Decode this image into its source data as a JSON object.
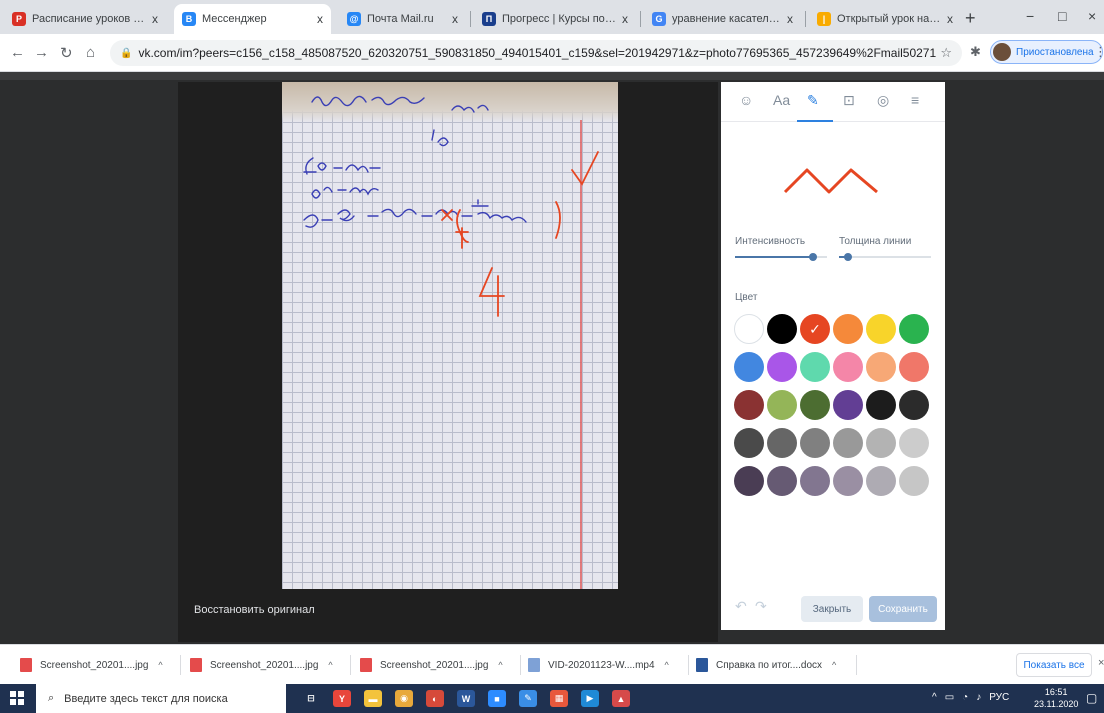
{
  "browser": {
    "tabs": [
      {
        "title": "Расписание уроков на II чет",
        "fav_color": "#d93025",
        "fav_glyph": "Р",
        "active": false
      },
      {
        "title": "Мессенджер",
        "fav_color": "#2787f5",
        "fav_glyph": "В",
        "active": true
      },
      {
        "title": "Почта Mail.ru",
        "fav_color": "#2787f5",
        "fav_glyph": "@",
        "active": false
      },
      {
        "title": "Прогресс | Курсы повыше",
        "fav_color": "#1a3e8c",
        "fav_glyph": "П",
        "active": false
      },
      {
        "title": "уравнение касательной БА",
        "fav_color": "#4285f4",
        "fav_glyph": "G",
        "active": false
      },
      {
        "title": "Открытый урок на тему: Ур",
        "fav_color": "#f9ab00",
        "fav_glyph": "|",
        "active": false
      }
    ],
    "tab_close": "x",
    "new_tab": "+",
    "window_controls": [
      "−",
      "□",
      "×"
    ],
    "url": "vk.com/im?peers=c156_c158_485087520_620320751_590831850_494015401_c159&sel=201942971&z=photo77695365_457239649%2Fmail50271",
    "profile_label": "Приостановлена"
  },
  "editor": {
    "tab_icons": [
      "smile-icon",
      "text-icon",
      "brush-icon",
      "crop-icon",
      "filter-icon",
      "settings-icon"
    ],
    "text_tab_label": "Aa",
    "intensity_label": "Интенсивность",
    "intensity_value": 0.85,
    "thickness_label": "Толщина линии",
    "thickness_value": 0.1,
    "color_label": "Цвет",
    "selected_color": "#e64622",
    "colors": [
      "#ffffff",
      "#000000",
      "#e64622",
      "#f5893a",
      "#f8d42a",
      "#2ab34f",
      "#4287e0",
      "#a956e8",
      "#5fd9ad",
      "#f486a8",
      "#f7a876",
      "#f07769",
      "#8a3232",
      "#94b558",
      "#4c6d31",
      "#623e94",
      "#1c1c1c",
      "#2b2b2b",
      "#4a4a4a",
      "#666666",
      "#808080",
      "#999999",
      "#b3b3b3",
      "#cccccc",
      "#4a3d54",
      "#665a73",
      "#827690",
      "#9a8fa3",
      "#aeabb3",
      "#c6c6c6"
    ],
    "close_label": "Закрыть",
    "save_label": "Сохранить"
  },
  "viewer": {
    "restore_label": "Восстановить оригинал"
  },
  "downloads": {
    "items": [
      {
        "name": "Screenshot_20201....jpg",
        "icon_color": "#e44b4b"
      },
      {
        "name": "Screenshot_20201....jpg",
        "icon_color": "#e44b4b"
      },
      {
        "name": "Screenshot_20201....jpg",
        "icon_color": "#e44b4b"
      },
      {
        "name": "VID-20201123-W....mp4",
        "icon_color": "#7ea1d6"
      },
      {
        "name": "Справка по итог....docx",
        "icon_color": "#2b579a"
      }
    ],
    "show_all_label": "Показать все"
  },
  "taskbar": {
    "search_placeholder": "Введите здесь текст для поиска",
    "apps": [
      {
        "name": "task-view-icon",
        "color": "#1f3150",
        "glyph": "⊟"
      },
      {
        "name": "yandex-browser-icon",
        "color": "#e8463b",
        "glyph": "Y"
      },
      {
        "name": "file-explorer-icon",
        "color": "#f3c33c",
        "glyph": "▬"
      },
      {
        "name": "chrome-icon",
        "color": "#e8a93b",
        "glyph": "◉"
      },
      {
        "name": "app-icon",
        "color": "#d64a3a",
        "glyph": "◐"
      },
      {
        "name": "word-icon",
        "color": "#2b579a",
        "glyph": "W"
      },
      {
        "name": "zoom-icon",
        "color": "#2d8cff",
        "glyph": "■"
      },
      {
        "name": "paint-icon",
        "color": "#3a8ee6",
        "glyph": "✎"
      },
      {
        "name": "office-icon",
        "color": "#e8583c",
        "glyph": "▦"
      },
      {
        "name": "media-icon",
        "color": "#1f8ad6",
        "glyph": "▶"
      },
      {
        "name": "pdf-icon",
        "color": "#d64a4a",
        "glyph": "▲"
      }
    ],
    "language": "РУС",
    "time": "16:51",
    "date": "23.11.2020"
  }
}
